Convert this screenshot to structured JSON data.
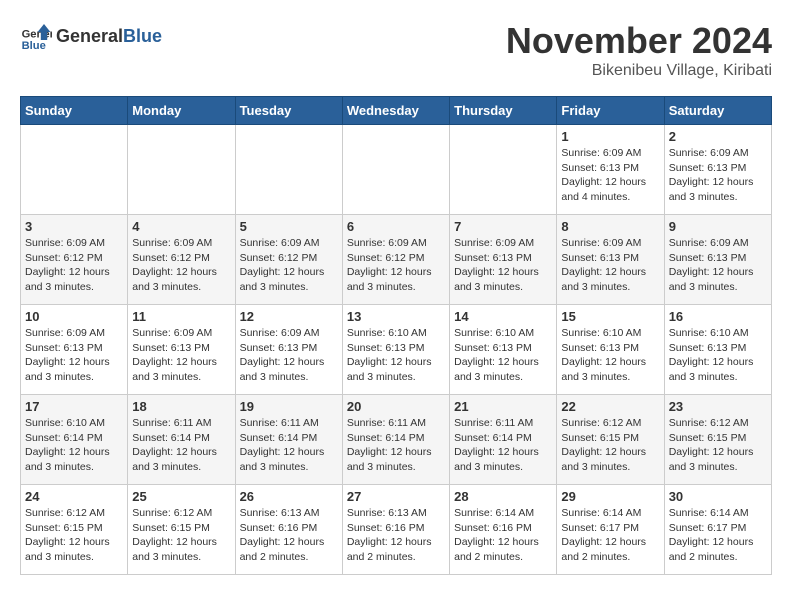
{
  "header": {
    "logo_general": "General",
    "logo_blue": "Blue",
    "month": "November 2024",
    "location": "Bikenibeu Village, Kiribati"
  },
  "weekdays": [
    "Sunday",
    "Monday",
    "Tuesday",
    "Wednesday",
    "Thursday",
    "Friday",
    "Saturday"
  ],
  "weeks": [
    [
      {
        "day": "",
        "info": ""
      },
      {
        "day": "",
        "info": ""
      },
      {
        "day": "",
        "info": ""
      },
      {
        "day": "",
        "info": ""
      },
      {
        "day": "",
        "info": ""
      },
      {
        "day": "1",
        "info": "Sunrise: 6:09 AM\nSunset: 6:13 PM\nDaylight: 12 hours and 4 minutes."
      },
      {
        "day": "2",
        "info": "Sunrise: 6:09 AM\nSunset: 6:13 PM\nDaylight: 12 hours and 3 minutes."
      }
    ],
    [
      {
        "day": "3",
        "info": "Sunrise: 6:09 AM\nSunset: 6:12 PM\nDaylight: 12 hours and 3 minutes."
      },
      {
        "day": "4",
        "info": "Sunrise: 6:09 AM\nSunset: 6:12 PM\nDaylight: 12 hours and 3 minutes."
      },
      {
        "day": "5",
        "info": "Sunrise: 6:09 AM\nSunset: 6:12 PM\nDaylight: 12 hours and 3 minutes."
      },
      {
        "day": "6",
        "info": "Sunrise: 6:09 AM\nSunset: 6:12 PM\nDaylight: 12 hours and 3 minutes."
      },
      {
        "day": "7",
        "info": "Sunrise: 6:09 AM\nSunset: 6:13 PM\nDaylight: 12 hours and 3 minutes."
      },
      {
        "day": "8",
        "info": "Sunrise: 6:09 AM\nSunset: 6:13 PM\nDaylight: 12 hours and 3 minutes."
      },
      {
        "day": "9",
        "info": "Sunrise: 6:09 AM\nSunset: 6:13 PM\nDaylight: 12 hours and 3 minutes."
      }
    ],
    [
      {
        "day": "10",
        "info": "Sunrise: 6:09 AM\nSunset: 6:13 PM\nDaylight: 12 hours and 3 minutes."
      },
      {
        "day": "11",
        "info": "Sunrise: 6:09 AM\nSunset: 6:13 PM\nDaylight: 12 hours and 3 minutes."
      },
      {
        "day": "12",
        "info": "Sunrise: 6:09 AM\nSunset: 6:13 PM\nDaylight: 12 hours and 3 minutes."
      },
      {
        "day": "13",
        "info": "Sunrise: 6:10 AM\nSunset: 6:13 PM\nDaylight: 12 hours and 3 minutes."
      },
      {
        "day": "14",
        "info": "Sunrise: 6:10 AM\nSunset: 6:13 PM\nDaylight: 12 hours and 3 minutes."
      },
      {
        "day": "15",
        "info": "Sunrise: 6:10 AM\nSunset: 6:13 PM\nDaylight: 12 hours and 3 minutes."
      },
      {
        "day": "16",
        "info": "Sunrise: 6:10 AM\nSunset: 6:13 PM\nDaylight: 12 hours and 3 minutes."
      }
    ],
    [
      {
        "day": "17",
        "info": "Sunrise: 6:10 AM\nSunset: 6:14 PM\nDaylight: 12 hours and 3 minutes."
      },
      {
        "day": "18",
        "info": "Sunrise: 6:11 AM\nSunset: 6:14 PM\nDaylight: 12 hours and 3 minutes."
      },
      {
        "day": "19",
        "info": "Sunrise: 6:11 AM\nSunset: 6:14 PM\nDaylight: 12 hours and 3 minutes."
      },
      {
        "day": "20",
        "info": "Sunrise: 6:11 AM\nSunset: 6:14 PM\nDaylight: 12 hours and 3 minutes."
      },
      {
        "day": "21",
        "info": "Sunrise: 6:11 AM\nSunset: 6:14 PM\nDaylight: 12 hours and 3 minutes."
      },
      {
        "day": "22",
        "info": "Sunrise: 6:12 AM\nSunset: 6:15 PM\nDaylight: 12 hours and 3 minutes."
      },
      {
        "day": "23",
        "info": "Sunrise: 6:12 AM\nSunset: 6:15 PM\nDaylight: 12 hours and 3 minutes."
      }
    ],
    [
      {
        "day": "24",
        "info": "Sunrise: 6:12 AM\nSunset: 6:15 PM\nDaylight: 12 hours and 3 minutes."
      },
      {
        "day": "25",
        "info": "Sunrise: 6:12 AM\nSunset: 6:15 PM\nDaylight: 12 hours and 3 minutes."
      },
      {
        "day": "26",
        "info": "Sunrise: 6:13 AM\nSunset: 6:16 PM\nDaylight: 12 hours and 2 minutes."
      },
      {
        "day": "27",
        "info": "Sunrise: 6:13 AM\nSunset: 6:16 PM\nDaylight: 12 hours and 2 minutes."
      },
      {
        "day": "28",
        "info": "Sunrise: 6:14 AM\nSunset: 6:16 PM\nDaylight: 12 hours and 2 minutes."
      },
      {
        "day": "29",
        "info": "Sunrise: 6:14 AM\nSunset: 6:17 PM\nDaylight: 12 hours and 2 minutes."
      },
      {
        "day": "30",
        "info": "Sunrise: 6:14 AM\nSunset: 6:17 PM\nDaylight: 12 hours and 2 minutes."
      }
    ]
  ]
}
